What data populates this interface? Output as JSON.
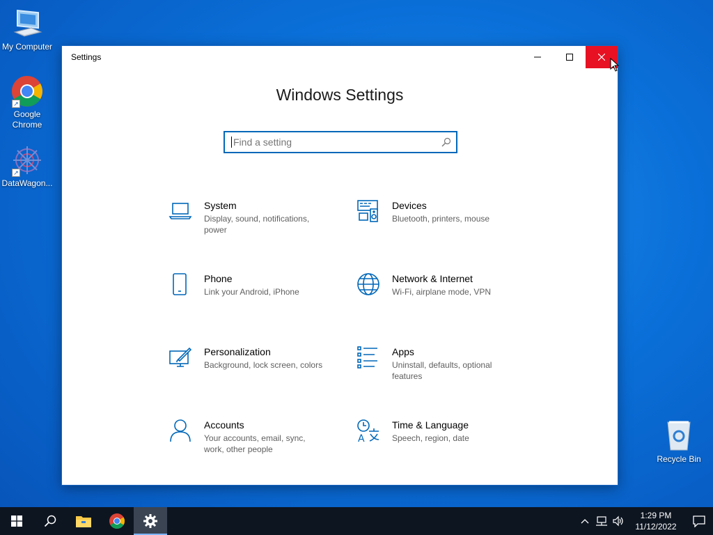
{
  "desktop": {
    "icons": [
      {
        "label": "My Computer"
      },
      {
        "label": "Google Chrome"
      },
      {
        "label": "DataWagon..."
      }
    ],
    "recycle_bin": "Recycle Bin"
  },
  "window": {
    "title": "Settings",
    "heading": "Windows Settings",
    "search_placeholder": "Find a setting",
    "tiles": [
      {
        "name": "System",
        "desc": "Display, sound, notifications, power",
        "icon": "laptop-icon"
      },
      {
        "name": "Devices",
        "desc": "Bluetooth, printers, mouse",
        "icon": "devices-icon"
      },
      {
        "name": "Phone",
        "desc": "Link your Android, iPhone",
        "icon": "phone-icon"
      },
      {
        "name": "Network & Internet",
        "desc": "Wi-Fi, airplane mode, VPN",
        "icon": "globe-icon"
      },
      {
        "name": "Personalization",
        "desc": "Background, lock screen, colors",
        "icon": "paint-icon"
      },
      {
        "name": "Apps",
        "desc": "Uninstall, defaults, optional features",
        "icon": "apps-list-icon"
      },
      {
        "name": "Accounts",
        "desc": "Your accounts, email, sync, work, other people",
        "icon": "person-icon"
      },
      {
        "name": "Time & Language",
        "desc": "Speech, region, date",
        "icon": "time-language-icon"
      }
    ]
  },
  "taskbar": {
    "time": "1:29 PM",
    "date": "11/12/2022"
  },
  "colors": {
    "accent": "#0067b8",
    "close": "#e81123",
    "taskbar": "#0d1521"
  }
}
